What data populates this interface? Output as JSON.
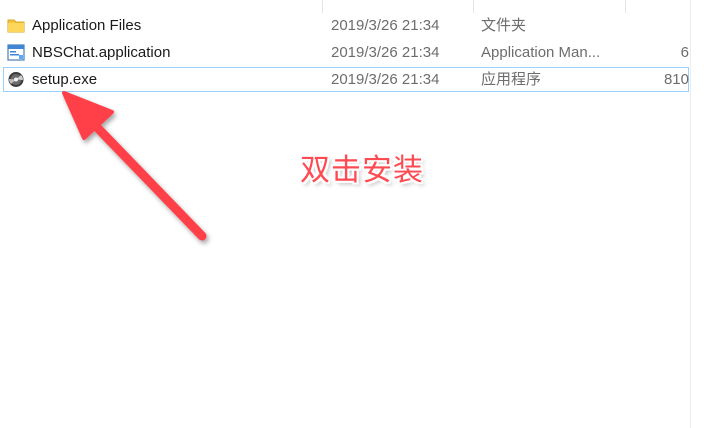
{
  "files": [
    {
      "name": "Application Files",
      "modified": "2019/3/26 21:34",
      "type": "文件夹",
      "size": "",
      "icon": "folder-icon",
      "selected": false
    },
    {
      "name": "NBSChat.application",
      "modified": "2019/3/26 21:34",
      "type": "Application Man...",
      "size": "6",
      "icon": "application-manifest-icon",
      "selected": false
    },
    {
      "name": "setup.exe",
      "modified": "2019/3/26 21:34",
      "type": "应用程序",
      "size": "810",
      "icon": "setup-disc-icon",
      "selected": true
    }
  ],
  "annotation": {
    "text": "双击安装",
    "color": "#ff4a52"
  },
  "colors": {
    "selection_border": "#99d1ff",
    "folder": "#f4c542",
    "secondary_text": "#6d6d6d"
  }
}
